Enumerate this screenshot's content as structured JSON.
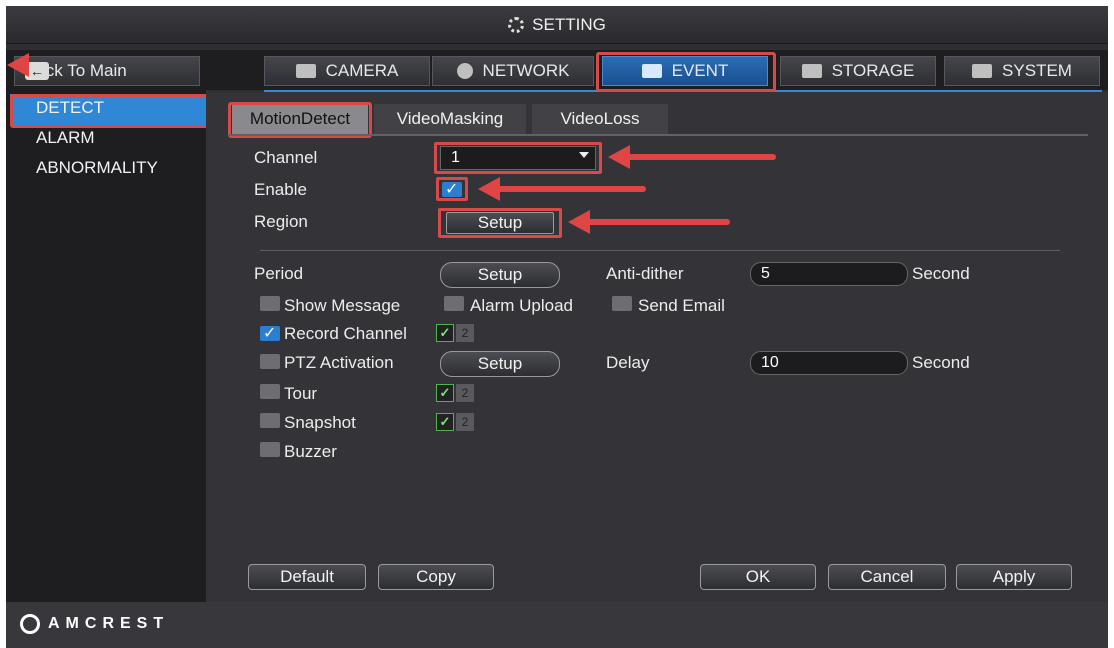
{
  "title": "SETTING",
  "nav": {
    "back_label": "Back To Main",
    "tabs": [
      {
        "label": "CAMERA",
        "icon": "camera-icon"
      },
      {
        "label": "NETWORK",
        "icon": "network-icon"
      },
      {
        "label": "EVENT",
        "icon": "event-icon"
      },
      {
        "label": "STORAGE",
        "icon": "storage-icon"
      },
      {
        "label": "SYSTEM",
        "icon": "system-icon"
      }
    ]
  },
  "sidebar": {
    "items": [
      {
        "label": "DETECT"
      },
      {
        "label": "ALARM"
      },
      {
        "label": "ABNORMALITY"
      }
    ]
  },
  "subtabs": [
    {
      "label": "MotionDetect"
    },
    {
      "label": "VideoMasking"
    },
    {
      "label": "VideoLoss"
    }
  ],
  "form": {
    "channel_label": "Channel",
    "channel_value": "1",
    "enable_label": "Enable",
    "region_label": "Region",
    "region_button": "Setup",
    "period_label": "Period",
    "period_button": "Setup",
    "antidither_label": "Anti-dither",
    "antidither_value": "5",
    "antidither_unit": "Second",
    "show_message": "Show Message",
    "alarm_upload": "Alarm Upload",
    "send_email": "Send Email",
    "record_channel": "Record Channel",
    "ptz_activation": "PTZ Activation",
    "ptz_button": "Setup",
    "delay_label": "Delay",
    "delay_value": "10",
    "delay_unit": "Second",
    "tour": "Tour",
    "snapshot": "Snapshot",
    "buzzer": "Buzzer",
    "channel_num_2": "2"
  },
  "buttons": {
    "default": "Default",
    "copy": "Copy",
    "ok": "OK",
    "cancel": "Cancel",
    "apply": "Apply"
  },
  "brand": "AMCREST",
  "colors": {
    "accent": "#2f87d6",
    "highlight": "#d74a4a"
  }
}
